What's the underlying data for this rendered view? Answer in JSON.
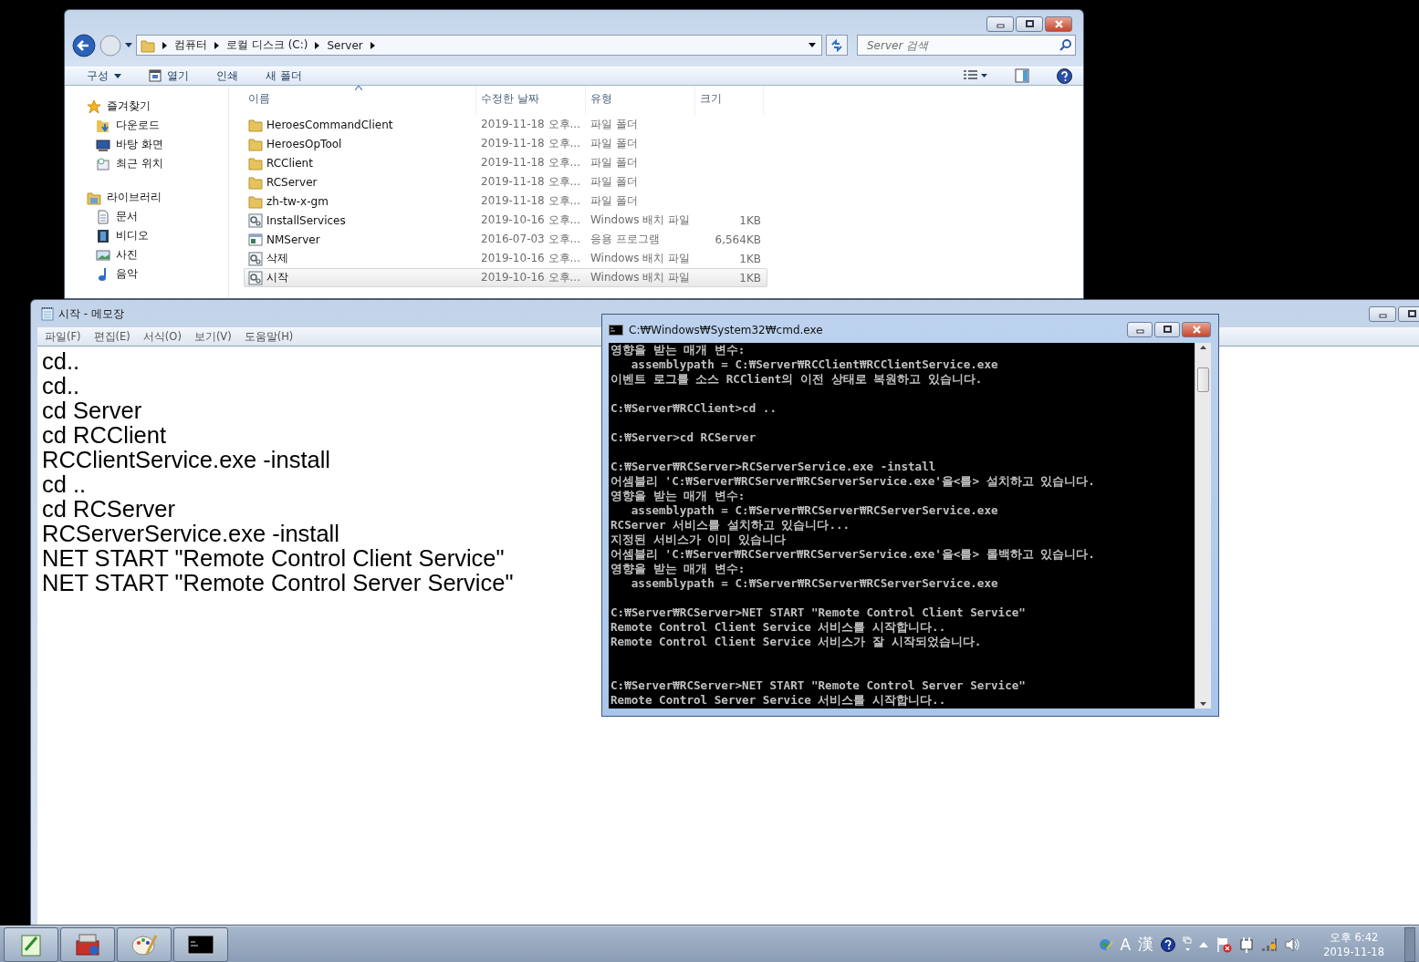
{
  "explorer": {
    "breadcrumb": [
      "컴퓨터",
      "로컬 디스크 (C:)",
      "Server"
    ],
    "search": {
      "placeholder": "Server 검색"
    },
    "toolbar": [
      {
        "label": "구성",
        "kind": "menu"
      },
      {
        "label": "열기",
        "kind": "open"
      },
      {
        "label": "인쇄",
        "kind": "plain"
      },
      {
        "label": "새 폴더",
        "kind": "plain"
      }
    ],
    "sidebar": [
      {
        "label": "즐겨찾기",
        "kind": "star",
        "children": [
          {
            "label": "다운로드",
            "kind": "download"
          },
          {
            "label": "바탕 화면",
            "kind": "desktop"
          },
          {
            "label": "최근 위치",
            "kind": "recent"
          }
        ]
      },
      {
        "label": "라이브러리",
        "kind": "library",
        "children": [
          {
            "label": "문서",
            "kind": "document"
          },
          {
            "label": "비디오",
            "kind": "video"
          },
          {
            "label": "사진",
            "kind": "picture"
          },
          {
            "label": "음악",
            "kind": "music"
          }
        ]
      }
    ],
    "columns": [
      "이름",
      "수정한 날짜",
      "유형",
      "크기"
    ],
    "rows": [
      {
        "name": "HeroesCommandClient",
        "date": "2019-11-18 오후...",
        "type": "파일 폴더",
        "kind": "folder",
        "selected": false
      },
      {
        "name": "HeroesOpTool",
        "date": "2019-11-18 오후...",
        "type": "파일 폴더",
        "kind": "folder",
        "selected": false
      },
      {
        "name": "RCClient",
        "date": "2019-11-18 오후...",
        "type": "파일 폴더",
        "kind": "folder",
        "selected": false
      },
      {
        "name": "RCServer",
        "date": "2019-11-18 오후...",
        "type": "파일 폴더",
        "kind": "folder",
        "selected": false
      },
      {
        "name": "zh-tw-x-gm",
        "date": "2019-11-18 오후...",
        "type": "파일 폴더",
        "kind": "folder",
        "selected": false
      },
      {
        "name": "InstallServices",
        "date": "2019-10-16 오후...",
        "type": "Windows 배치 파일",
        "size": "1KB",
        "kind": "batch",
        "selected": false
      },
      {
        "name": "NMServer",
        "date": "2016-07-03 오후...",
        "type": "응용 프로그램",
        "size": "6,564KB",
        "kind": "app",
        "selected": false
      },
      {
        "name": "삭제",
        "date": "2019-10-16 오후...",
        "type": "Windows 배치 파일",
        "size": "1KB",
        "kind": "batch",
        "selected": false
      },
      {
        "name": "시작",
        "date": "2019-10-16 오후...",
        "type": "Windows 배치 파일",
        "size": "1KB",
        "kind": "batch",
        "selected": true
      }
    ]
  },
  "notepad": {
    "title": "시작 - 메모장",
    "menu": [
      "파일(F)",
      "편집(E)",
      "서식(O)",
      "보기(V)",
      "도움말(H)"
    ],
    "lines": [
      "cd..",
      "cd..",
      "cd Server",
      "cd RCClient",
      "RCClientService.exe -install",
      "cd ..",
      "cd RCServer",
      "RCServerService.exe -install",
      "NET START \"Remote Control Client Service\"",
      "NET START \"Remote Control Server Service\""
    ]
  },
  "cmd": {
    "title": "C:₩Windows₩System32₩cmd.exe",
    "blocks": [
      {
        "wide_gap": false,
        "lines": [
          "영향을 받는 매개 변수:",
          "   assemblypath = C:₩Server₩RCClient₩RCClientService.exe",
          "이벤트 로그를 소스 RCClient의 이전 상태로 복원하고 있습니다."
        ]
      },
      {
        "wide_gap": false,
        "lines": [
          "C:₩Server₩RCClient>cd .."
        ]
      },
      {
        "wide_gap": false,
        "lines": [
          "C:₩Server>cd RCServer"
        ]
      },
      {
        "wide_gap": false,
        "lines": [
          "C:₩Server₩RCServer>RCServerService.exe -install",
          "어셈블리 'C:₩Server₩RCServer₩RCServerService.exe'을<를> 설치하고 있습니다.",
          "영향을 받는 매개 변수:",
          "   assemblypath = C:₩Server₩RCServer₩RCServerService.exe",
          "RCServer 서비스를 설치하고 있습니다...",
          "지정된 서비스가 이미 있습니다",
          "어셈블리 'C:₩Server₩RCServer₩RCServerService.exe'을<를> 롤백하고 있습니다.",
          "영향을 받는 매개 변수:",
          "   assemblypath = C:₩Server₩RCServer₩RCServerService.exe"
        ]
      },
      {
        "wide_gap": false,
        "lines": [
          "C:₩Server₩RCServer>NET START \"Remote Control Client Service\"",
          "Remote Control Client Service 서비스를 시작합니다..",
          "Remote Control Client Service 서비스가 잘 시작되었습니다."
        ]
      },
      {
        "wide_gap": true,
        "lines": [
          "C:₩Server₩RCServer>NET START \"Remote Control Server Service\"",
          "Remote Control Server Service 서비스를 시작합니다.."
        ]
      }
    ]
  },
  "taskbar": {
    "apps": [
      {
        "kind": "notepad"
      },
      {
        "kind": "toolbox"
      },
      {
        "kind": "paint"
      },
      {
        "kind": "cmd"
      }
    ],
    "ime": [
      "A",
      "漢"
    ],
    "time": "오후 6:42",
    "date": "2019-11-18"
  }
}
